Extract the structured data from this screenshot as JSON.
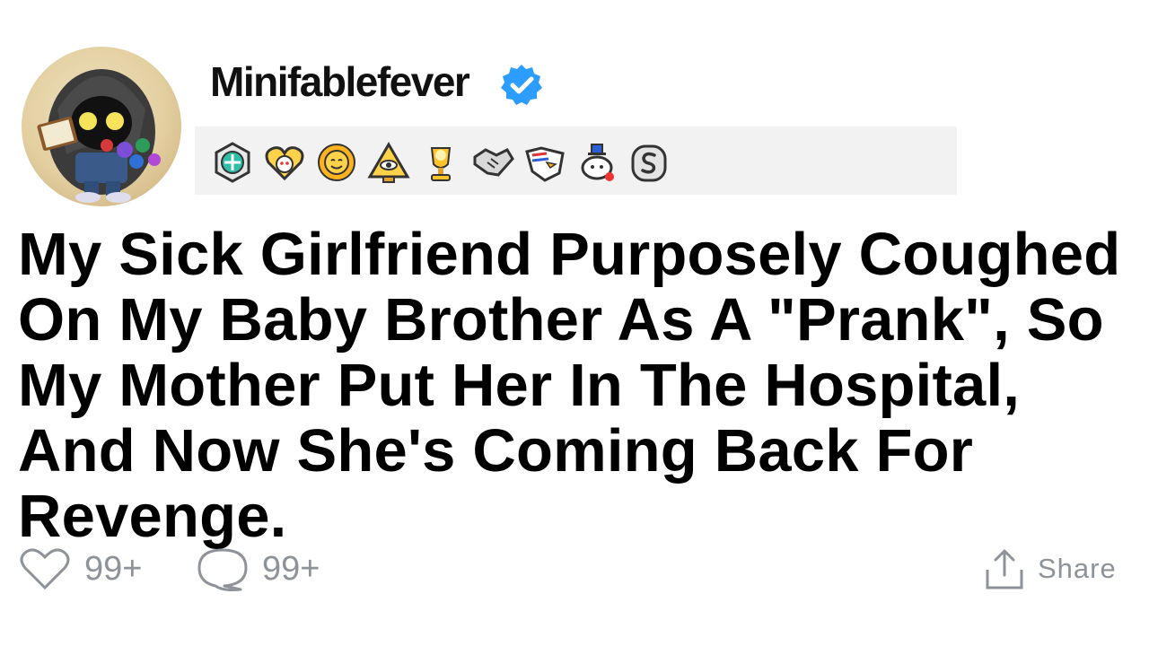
{
  "post": {
    "username": "Minifablefever",
    "title": "My Sick Girlfriend Purposely Coughed On My Baby Brother As A \"Prank\", So My Mother Put Her In The Hospital, And Now She's Coming Back For Revenge."
  },
  "awards": [
    "helpful-hexagon-icon",
    "wholesome-heart-icon",
    "sunny-face-icon",
    "eye-pyramid-icon",
    "gold-trophy-icon",
    "handshake-icon",
    "eagle-flag-icon",
    "snoo-hat-icon",
    "silver-s-icon"
  ],
  "actions": {
    "likes": "99+",
    "comments": "99+",
    "share_label": "Share"
  },
  "colors": {
    "verified": "#2d9cff",
    "action_gray": "#8e9399",
    "award_bar": "#f2f2f2"
  }
}
